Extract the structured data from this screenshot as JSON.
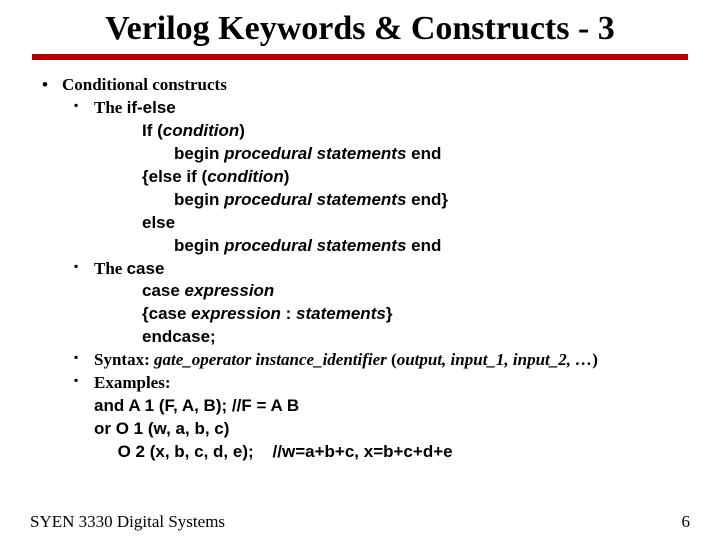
{
  "title": "Verilog Keywords & Constructs - 3",
  "b1": "Conditional constructs",
  "ifelse_pre": "The ",
  "ifelse_kw": "if-else",
  "if_kw": "If (",
  "if_cond": "condition",
  "if_close": ")",
  "begin_kw": "begin ",
  "proc_i": "procedural statements",
  "end_kw": " end",
  "elseif_open": "{",
  "elseif_kw": "else if (",
  "elseif_cond": "condition",
  "elseif_close": ")",
  "end_brace": " end}",
  "else_kw": "else",
  "case_pre": "The ",
  "case_kw": "case",
  "case_expr_kw": "case ",
  "case_expr_i": "expression",
  "case_line3_open": "{",
  "case_line3_kw": "case ",
  "case_line3_exp": "expression",
  "case_line3_mid": " : ",
  "case_line3_stmt": "statements",
  "case_line3_close": "}",
  "endcase_kw": "endcase;",
  "syntax_pre": "Syntax: ",
  "syntax_gate": "gate_operator instance_identifier ",
  "syntax_rest": "(",
  "syntax_args": "output, input_1, input_2, …",
  "syntax_rest2": ")",
  "examples_lbl": "Examples:",
  "ex1": "and A 1 (F, A, B); //F = A B",
  "ex2": "or O 1 (w, a, b, c)",
  "ex3_code": "     O 2 (x, b, c, d, e);",
  "ex3_pad": "    ",
  "ex3_cmt": "//w=a+b+c, x=b+c+d+e",
  "footer_left": "SYEN 3330 Digital Systems",
  "footer_right": "6"
}
